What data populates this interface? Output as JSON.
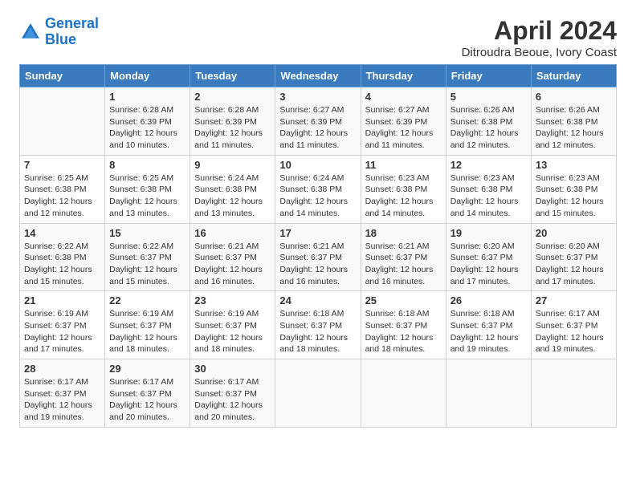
{
  "logo": {
    "line1": "General",
    "line2": "Blue"
  },
  "title": "April 2024",
  "subtitle": "Ditroudra Beoue, Ivory Coast",
  "days_of_week": [
    "Sunday",
    "Monday",
    "Tuesday",
    "Wednesday",
    "Thursday",
    "Friday",
    "Saturday"
  ],
  "weeks": [
    [
      {
        "day": "",
        "content": ""
      },
      {
        "day": "1",
        "content": "Sunrise: 6:28 AM\nSunset: 6:39 PM\nDaylight: 12 hours\nand 10 minutes."
      },
      {
        "day": "2",
        "content": "Sunrise: 6:28 AM\nSunset: 6:39 PM\nDaylight: 12 hours\nand 11 minutes."
      },
      {
        "day": "3",
        "content": "Sunrise: 6:27 AM\nSunset: 6:39 PM\nDaylight: 12 hours\nand 11 minutes."
      },
      {
        "day": "4",
        "content": "Sunrise: 6:27 AM\nSunset: 6:39 PM\nDaylight: 12 hours\nand 11 minutes."
      },
      {
        "day": "5",
        "content": "Sunrise: 6:26 AM\nSunset: 6:38 PM\nDaylight: 12 hours\nand 12 minutes."
      },
      {
        "day": "6",
        "content": "Sunrise: 6:26 AM\nSunset: 6:38 PM\nDaylight: 12 hours\nand 12 minutes."
      }
    ],
    [
      {
        "day": "7",
        "content": "Sunrise: 6:25 AM\nSunset: 6:38 PM\nDaylight: 12 hours\nand 12 minutes."
      },
      {
        "day": "8",
        "content": "Sunrise: 6:25 AM\nSunset: 6:38 PM\nDaylight: 12 hours\nand 13 minutes."
      },
      {
        "day": "9",
        "content": "Sunrise: 6:24 AM\nSunset: 6:38 PM\nDaylight: 12 hours\nand 13 minutes."
      },
      {
        "day": "10",
        "content": "Sunrise: 6:24 AM\nSunset: 6:38 PM\nDaylight: 12 hours\nand 14 minutes."
      },
      {
        "day": "11",
        "content": "Sunrise: 6:23 AM\nSunset: 6:38 PM\nDaylight: 12 hours\nand 14 minutes."
      },
      {
        "day": "12",
        "content": "Sunrise: 6:23 AM\nSunset: 6:38 PM\nDaylight: 12 hours\nand 14 minutes."
      },
      {
        "day": "13",
        "content": "Sunrise: 6:23 AM\nSunset: 6:38 PM\nDaylight: 12 hours\nand 15 minutes."
      }
    ],
    [
      {
        "day": "14",
        "content": "Sunrise: 6:22 AM\nSunset: 6:38 PM\nDaylight: 12 hours\nand 15 minutes."
      },
      {
        "day": "15",
        "content": "Sunrise: 6:22 AM\nSunset: 6:37 PM\nDaylight: 12 hours\nand 15 minutes."
      },
      {
        "day": "16",
        "content": "Sunrise: 6:21 AM\nSunset: 6:37 PM\nDaylight: 12 hours\nand 16 minutes."
      },
      {
        "day": "17",
        "content": "Sunrise: 6:21 AM\nSunset: 6:37 PM\nDaylight: 12 hours\nand 16 minutes."
      },
      {
        "day": "18",
        "content": "Sunrise: 6:21 AM\nSunset: 6:37 PM\nDaylight: 12 hours\nand 16 minutes."
      },
      {
        "day": "19",
        "content": "Sunrise: 6:20 AM\nSunset: 6:37 PM\nDaylight: 12 hours\nand 17 minutes."
      },
      {
        "day": "20",
        "content": "Sunrise: 6:20 AM\nSunset: 6:37 PM\nDaylight: 12 hours\nand 17 minutes."
      }
    ],
    [
      {
        "day": "21",
        "content": "Sunrise: 6:19 AM\nSunset: 6:37 PM\nDaylight: 12 hours\nand 17 minutes."
      },
      {
        "day": "22",
        "content": "Sunrise: 6:19 AM\nSunset: 6:37 PM\nDaylight: 12 hours\nand 18 minutes."
      },
      {
        "day": "23",
        "content": "Sunrise: 6:19 AM\nSunset: 6:37 PM\nDaylight: 12 hours\nand 18 minutes."
      },
      {
        "day": "24",
        "content": "Sunrise: 6:18 AM\nSunset: 6:37 PM\nDaylight: 12 hours\nand 18 minutes."
      },
      {
        "day": "25",
        "content": "Sunrise: 6:18 AM\nSunset: 6:37 PM\nDaylight: 12 hours\nand 18 minutes."
      },
      {
        "day": "26",
        "content": "Sunrise: 6:18 AM\nSunset: 6:37 PM\nDaylight: 12 hours\nand 19 minutes."
      },
      {
        "day": "27",
        "content": "Sunrise: 6:17 AM\nSunset: 6:37 PM\nDaylight: 12 hours\nand 19 minutes."
      }
    ],
    [
      {
        "day": "28",
        "content": "Sunrise: 6:17 AM\nSunset: 6:37 PM\nDaylight: 12 hours\nand 19 minutes."
      },
      {
        "day": "29",
        "content": "Sunrise: 6:17 AM\nSunset: 6:37 PM\nDaylight: 12 hours\nand 20 minutes."
      },
      {
        "day": "30",
        "content": "Sunrise: 6:17 AM\nSunset: 6:37 PM\nDaylight: 12 hours\nand 20 minutes."
      },
      {
        "day": "",
        "content": ""
      },
      {
        "day": "",
        "content": ""
      },
      {
        "day": "",
        "content": ""
      },
      {
        "day": "",
        "content": ""
      }
    ]
  ]
}
